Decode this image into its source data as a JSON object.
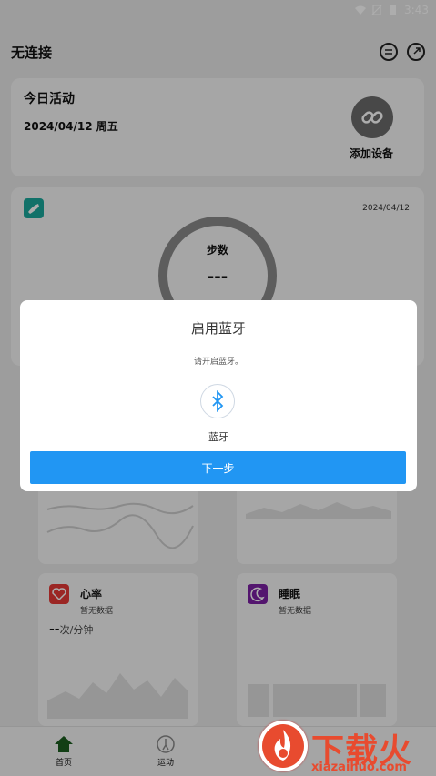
{
  "status_bar": {
    "time": "3:43"
  },
  "app_bar": {
    "title": "无连接"
  },
  "activity_card": {
    "title": "今日活动",
    "date": "2024/04/12 周五",
    "add_device": "添加设备"
  },
  "steps_card": {
    "date": "2024/04/12",
    "label": "步数",
    "value": "---"
  },
  "heart_rate": {
    "label": "心率",
    "sub": "暂无数据",
    "value": "--",
    "unit": "次/分钟",
    "color": "#e53935"
  },
  "sleep": {
    "label": "睡眠",
    "sub": "暂无数据",
    "color": "#7b1fa2"
  },
  "bottom_nav": {
    "items": [
      {
        "label": "首页",
        "icon": "home-icon"
      },
      {
        "label": "运动",
        "icon": "run-icon"
      }
    ]
  },
  "dialog": {
    "title": "启用蓝牙",
    "message": "请开启蓝牙。",
    "bt_label": "蓝牙",
    "next_button": "下一步",
    "accent": "#2196f3"
  },
  "watermark": {
    "text": "下载火",
    "url": "xiazaihuo.com"
  }
}
